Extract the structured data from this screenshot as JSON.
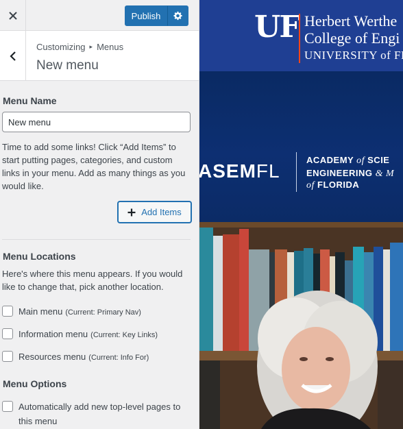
{
  "topbar": {
    "publish_label": "Publish"
  },
  "section": {
    "breadcrumb_parent": "Customizing",
    "breadcrumb_sep": "▸",
    "breadcrumb_current": "Menus",
    "title": "New menu"
  },
  "menu_name": {
    "label": "Menu Name",
    "value": "New menu"
  },
  "add_items": {
    "help": "Time to add some links! Click “Add Items” to start putting pages, categories, and custom links in your menu. Add as many things as you would like.",
    "button_label": "Add Items"
  },
  "locations": {
    "heading": "Menu Locations",
    "help": "Here's where this menu appears. If you would like to change that, pick another location.",
    "items": [
      {
        "label": "Main menu",
        "current": "(Current: Primary Nav)",
        "checked": false
      },
      {
        "label": "Information menu",
        "current": "(Current: Key Links)",
        "checked": false
      },
      {
        "label": "Resources menu",
        "current": "(Current: Info For)",
        "checked": false
      }
    ]
  },
  "options": {
    "heading": "Menu Options",
    "auto_add_label": "Automatically add new top-level pages to this menu",
    "auto_add_checked": false
  },
  "preview": {
    "uf_logo": "UF",
    "uf_line1": "Herbert Werthe",
    "uf_line2": "College of Engi",
    "uf_line3": "UNIVERSITY of FL",
    "asem_bold": "ASEM",
    "asem_light": "FL",
    "asem_line1_a": "ACADEMY",
    "asem_line1_b": "of",
    "asem_line1_c": "SCIE",
    "asem_line2_a": "ENGINEERING",
    "asem_line2_b": "& M",
    "asem_line3_a": "of",
    "asem_line3_b": "FLORIDA"
  },
  "colors": {
    "wp_blue": "#2271b1",
    "uf_blue": "#1f3f93",
    "uf_orange": "#fa4616",
    "asem_navy": "#0d2f72"
  }
}
